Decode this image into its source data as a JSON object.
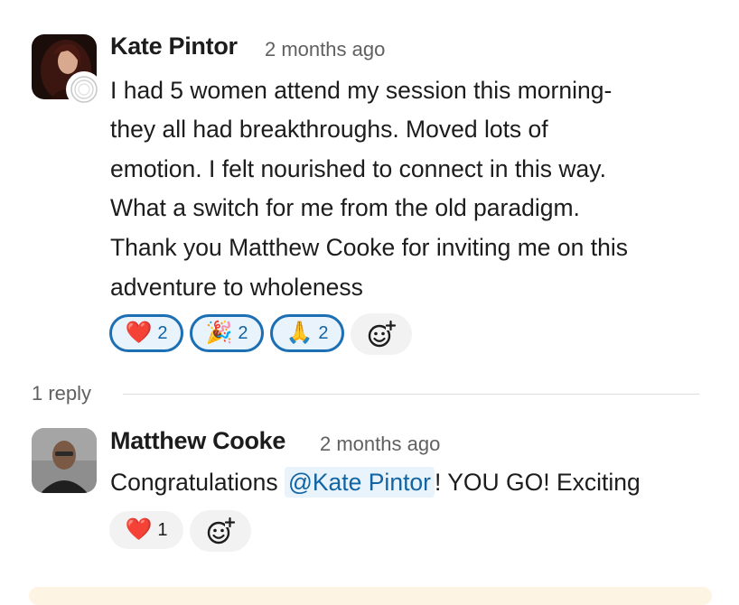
{
  "messages": [
    {
      "author": "Kate Pintor",
      "time": "2 months ago",
      "lines": [
        "I had 5 women attend my session this morning-",
        "they all had breakthroughs. Moved lots of",
        "emotion. I felt nourished to connect in this way.",
        "What a switch for me from the old paradigm.",
        "Thank you Matthew Cooke for inviting me on this",
        "adventure to wholeness"
      ],
      "reactions": [
        {
          "emoji": "❤️",
          "icon": "heart-icon",
          "count": "2"
        },
        {
          "emoji": "🎉",
          "icon": "party-popper-icon",
          "count": "2"
        },
        {
          "emoji": "🙏",
          "icon": "folded-hands-icon",
          "count": "2"
        }
      ]
    },
    {
      "author": "Matthew Cooke",
      "time": "2 months ago",
      "text_before": "Congratulations ",
      "mention": "@Kate Pintor",
      "text_after": "! YOU GO! Exciting",
      "reactions": [
        {
          "emoji": "❤️",
          "icon": "heart-icon",
          "count": "1"
        }
      ]
    }
  ],
  "thread": {
    "reply_count": "1 reply"
  },
  "colors": {
    "accent": "#1264a3",
    "active_border": "#1d6fb3",
    "mention_bg": "#e8f3fb",
    "muted": "#616061"
  }
}
